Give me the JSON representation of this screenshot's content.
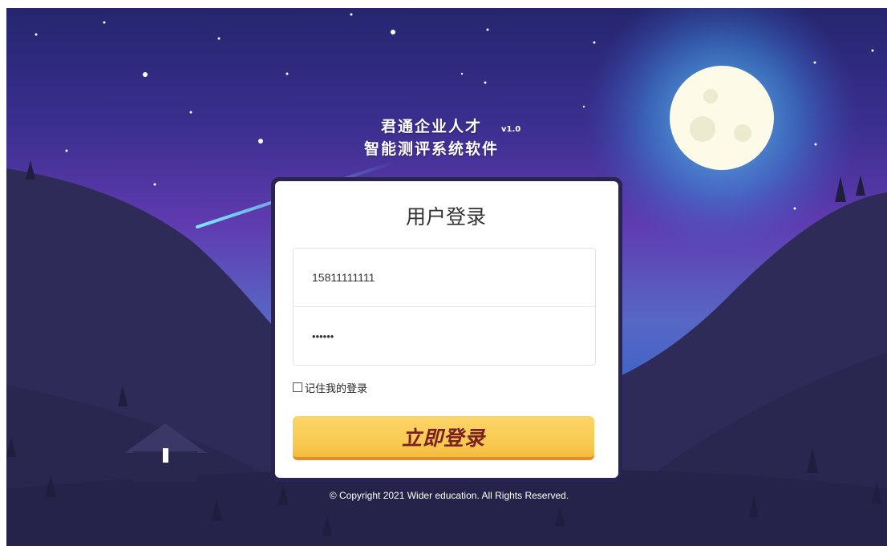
{
  "header": {
    "title_line1": "君通企业人才",
    "version": "v1.0",
    "title_line2": "智能测评系统软件"
  },
  "login": {
    "title": "用户登录",
    "username_value": "15811111111",
    "password_value": "••••••",
    "remember_label": "记住我的登录",
    "remember_checked": false,
    "submit_label": "立即登录"
  },
  "footer": {
    "copyright": "© Copyright 2021 Wider education. All Rights Reserved."
  },
  "colors": {
    "sky_top": "#25266f",
    "sky_mid": "#5f3bb0",
    "mountain": "#2d2a55",
    "button": "#f8c94f",
    "button_text": "#7a1f22",
    "moon": "#fdfbe8"
  }
}
